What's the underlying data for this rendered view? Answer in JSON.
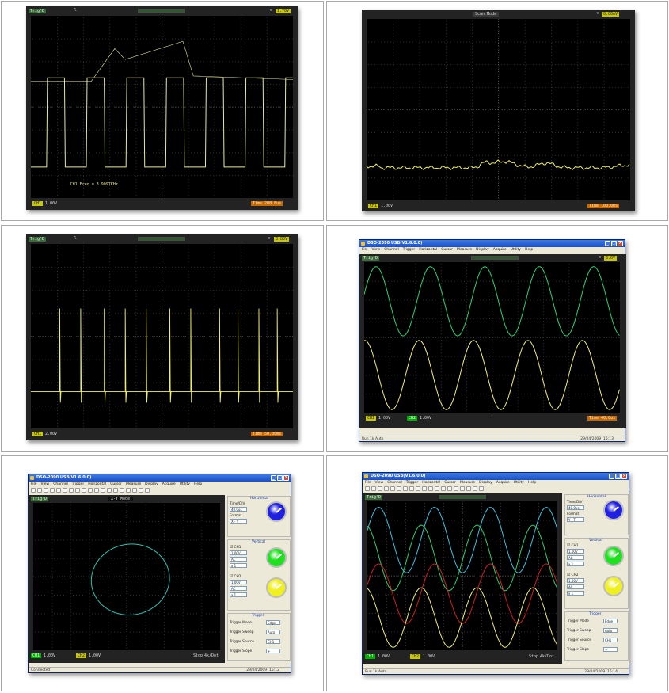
{
  "cell1": {
    "trig_label": "Trig'D",
    "ch_marker": "CH1",
    "volts": "1.00V",
    "time": "Time 200.0us",
    "trigger_level": "1.70V",
    "measurement": "CH1 Freq = 3.9097KHz",
    "colors": {
      "trace": "#e8e8a0",
      "trace_ch1": "#ffff66"
    }
  },
  "cell2": {
    "top_label": "Scan Mode",
    "trigger_level": "0.00mV",
    "ch_marker": "CH1",
    "volts": "1.00V",
    "time": "Time 100.0ms"
  },
  "cell3": {
    "trig_label": "Trig'D",
    "ch_marker": "CH1",
    "volts": "2.00V",
    "time": "Time 50.00ms",
    "trigger_level": "3.80V"
  },
  "cell4": {
    "title": "DSO-2090 USB(V1.6.0.0)",
    "menu": [
      "File",
      "View",
      "Channel",
      "Trigger",
      "Horizontal",
      "Cursor",
      "Measure",
      "Display",
      "Acquire",
      "Utility",
      "Help"
    ],
    "trig_label": "Trig'D",
    "ch1_volts": "1.00V",
    "ch2_volts": "1.00V",
    "time": "Time 40.0us",
    "status_left": "Run  1k  Auto",
    "status_date": "29/04/2009",
    "status_time": "15:13",
    "colors": {
      "ch1": "#f0f080",
      "ch2": "#30d070"
    }
  },
  "cell5": {
    "title": "DSO-2090 USB(V1.6.0.0)",
    "menu": [
      "File",
      "View",
      "Channel",
      "Trigger",
      "Horizontal",
      "Cursor",
      "Measure",
      "Display",
      "Acquire",
      "Utility",
      "Help"
    ],
    "trig_label": "Trig'D",
    "top_readout": "X-Y Mode",
    "ch1_volts": "1.00V",
    "ch2_volts": "1.00V",
    "stop_label": "Stop",
    "acq_label": "4k/Dot",
    "status_left": "Connected",
    "status_date": "29/04/2009",
    "status_time": "15:12",
    "panel": {
      "horizontal_title": "Horizontal",
      "timediv_label": "Time/DIV",
      "timediv_value": "40.0us",
      "format_label": "Format",
      "format_value": "X - Y",
      "vertical_title": "Vertical",
      "ch1_label": "CH1",
      "ch1_volts": "1.00V",
      "ch1_coupling": "AC",
      "ch1_probe": "x 1",
      "ch2_label": "CH2",
      "ch2_volts": "1.00V",
      "ch2_coupling": "AC",
      "ch2_probe": "x 1",
      "trigger_title": "Trigger",
      "trig_mode_label": "Trigger Mode",
      "trig_mode_value": "Edge",
      "trig_sweep_label": "Trigger Sweep",
      "trig_sweep_value": "Auto",
      "trig_source_label": "Trigger Source",
      "trig_source_value": "CH1",
      "trig_slope_label": "Trigger Slope",
      "trig_slope_value": "+"
    },
    "colors": {
      "trace": "#30c0b0",
      "knob_time": "#2020e0",
      "knob_ch1": "#20e020",
      "knob_ch2": "#f0f020"
    }
  },
  "cell6": {
    "title": "DSO-2090 USB(V1.6.0.0)",
    "menu": [
      "File",
      "View",
      "Channel",
      "Trigger",
      "Horizontal",
      "Cursor",
      "Measure",
      "Display",
      "Acquire",
      "Utility",
      "Help"
    ],
    "trig_label": "Trig'D",
    "ch1_volts": "1.00V",
    "ch2_volts": "1.00V",
    "stop_label": "Stop",
    "acq_label": "4k/Dot",
    "status_left": "Run  1k  Auto",
    "status_date": "29/04/2009",
    "status_time": "15:14",
    "panel": {
      "horizontal_title": "Horizontal",
      "timediv_label": "Time/DIV",
      "timediv_value": "40.0us",
      "format_label": "Format",
      "format_value": "Y - T",
      "vertical_title": "Vertical",
      "ch1_label": "CH1",
      "ch1_volts": "1.00V",
      "ch1_coupling": "AC",
      "ch1_probe": "x 1",
      "ch2_label": "CH2",
      "ch2_volts": "1.00V",
      "ch2_coupling": "AC",
      "ch2_probe": "x 1",
      "trigger_title": "Trigger",
      "trig_mode_label": "Trigger Mode",
      "trig_mode_value": "Edge",
      "trig_sweep_label": "Trigger Sweep",
      "trig_sweep_value": "Auto",
      "trig_source_label": "Trigger Source",
      "trig_source_value": "CH1",
      "trig_slope_label": "Trigger Slope",
      "trig_slope_value": "+"
    },
    "colors": {
      "ch1": "#f0f080",
      "ch2": "#30d070",
      "math": "#d02020",
      "ref": "#40c0e0",
      "knob_time": "#2020e0",
      "knob_ch1": "#20e020",
      "knob_ch2": "#f0f020"
    }
  }
}
